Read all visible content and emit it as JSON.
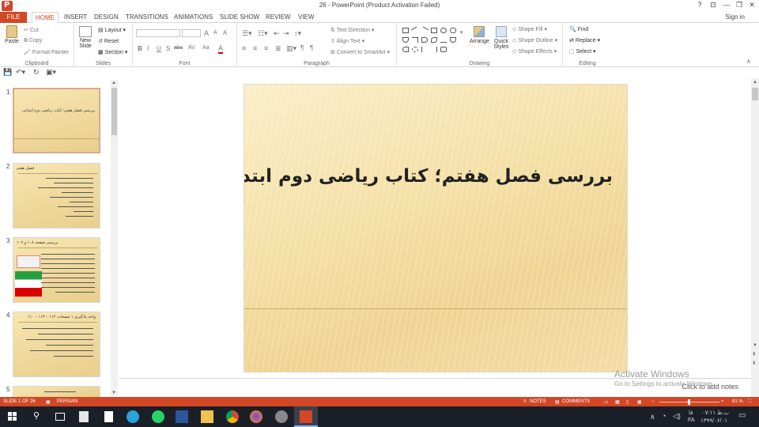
{
  "window": {
    "title": "26 - PowerPoint (Product Activation Failed)",
    "help": "?",
    "ribbon_display": "⊡",
    "minimize": "—",
    "restore": "❐",
    "close": "✕",
    "sign_in": "Sign in"
  },
  "tabs": [
    {
      "label": "FILE"
    },
    {
      "label": "HOME"
    },
    {
      "label": "INSERT"
    },
    {
      "label": "DESIGN"
    },
    {
      "label": "TRANSITIONS"
    },
    {
      "label": "ANIMATIONS"
    },
    {
      "label": "SLIDE SHOW"
    },
    {
      "label": "REVIEW"
    },
    {
      "label": "VIEW"
    }
  ],
  "ribbon": {
    "clipboard": {
      "paste": "Paste",
      "cut": "Cut",
      "copy": "Copy",
      "format_painter": "Format Painter",
      "label": "Clipboard"
    },
    "slides": {
      "new_slide": "New Slide",
      "layout": "Layout",
      "reset": "Reset",
      "section": "Section",
      "label": "Slides"
    },
    "font": {
      "bold": "B",
      "italic": "I",
      "underline": "U",
      "strike": "S",
      "shadow": "abc",
      "spacing": "AV",
      "case": "Aa",
      "color": "A",
      "grow": "A",
      "shrink": "A",
      "clear": "A",
      "label": "Font"
    },
    "paragraph": {
      "text_direction": "Text Direction",
      "align_text": "Align Text",
      "convert_smartart": "Convert to SmartArt",
      "label": "Paragraph"
    },
    "drawing": {
      "arrange": "Arrange",
      "quick_styles": "Quick Styles",
      "shape_fill": "Shape Fill",
      "shape_outline": "Shape Outline",
      "shape_effects": "Shape Effects",
      "label": "Drawing"
    },
    "editing": {
      "find": "Find",
      "replace": "Replace",
      "select": "Select",
      "label": "Editing"
    }
  },
  "thumbnails": [
    {
      "number": "1",
      "title": "بررسی فصل هفتم؛ کتاب ریاضی دوم ابتدایی"
    },
    {
      "number": "2",
      "title": "فصل هفتم"
    },
    {
      "number": "3",
      "title": "بررسی صفحه ۱۰۸ و ۱۰۹"
    },
    {
      "number": "4",
      "title": "واحد یادگیری ۱ صفحات ۱۱۲ – ۱۱۳ – ۱۱۰"
    },
    {
      "number": "5",
      "title": ""
    }
  ],
  "slide": {
    "title": "بررسی فصل هفتم؛ کتاب ریاضی دوم ابتدایی"
  },
  "notes_placeholder": "Click to add notes",
  "watermark": {
    "line1": "Activate Windows",
    "line2": "Go to Settings to activate Windows."
  },
  "status": {
    "slide": "SLIDE 1 OF 26",
    "language": "PERSIAN",
    "notes": "NOTES",
    "comments": "COMMENTS",
    "zoom": "81 %"
  },
  "tray": {
    "time": "۰۷:۱۱ ب.ظ",
    "date": "۱۳۹۹/۰۶/۰۱",
    "lang": "FA",
    "lang2": "فا"
  },
  "colors": {
    "accent": "#d24726",
    "taskbar": "#1b1f27"
  }
}
